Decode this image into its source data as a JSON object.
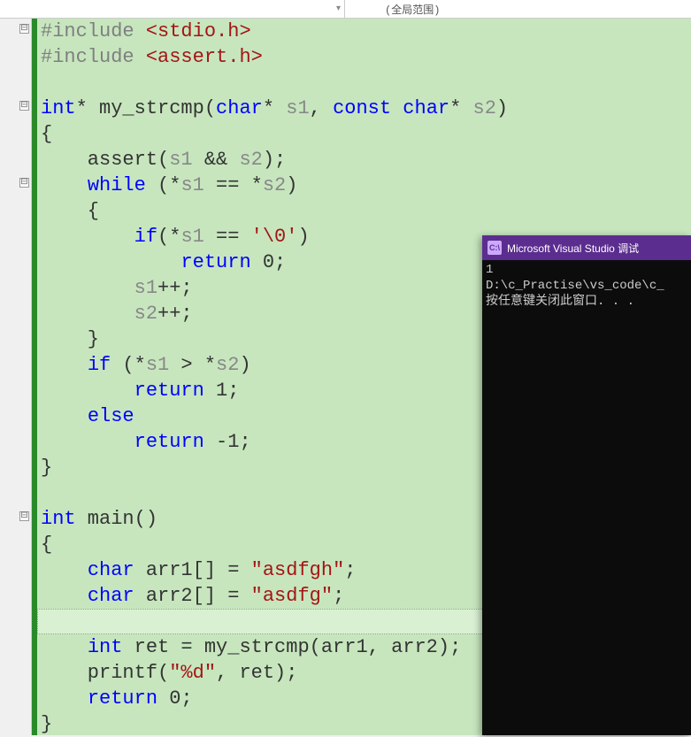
{
  "topbar": {
    "scope_label": "(全局范围)"
  },
  "fold": {
    "m1": "⊟",
    "m2": "⊟",
    "m3": "⊟",
    "m4": "⊟"
  },
  "code": {
    "l1_a": "#include ",
    "l1_b": "<stdio.h>",
    "l2_a": "#include ",
    "l2_b": "<assert.h>",
    "l4_a": "int",
    "l4_b": "* my_strcmp(",
    "l4_c": "char",
    "l4_d": "* ",
    "l4_e": "s1",
    "l4_f": ", ",
    "l4_g": "const",
    "l4_h": " ",
    "l4_i": "char",
    "l4_j": "* ",
    "l4_k": "s2",
    "l4_l": ")",
    "l5": "{",
    "l6_a": "    assert(",
    "l6_b": "s1",
    "l6_c": " && ",
    "l6_d": "s2",
    "l6_e": ");",
    "l7_a": "    ",
    "l7_b": "while",
    "l7_c": " (*",
    "l7_d": "s1",
    "l7_e": " == *",
    "l7_f": "s2",
    "l7_g": ")",
    "l8": "    {",
    "l9_a": "        ",
    "l9_b": "if",
    "l9_c": "(*",
    "l9_d": "s1",
    "l9_e": " == ",
    "l9_f": "'\\0'",
    "l9_g": ")",
    "l10_a": "            ",
    "l10_b": "return",
    "l10_c": " 0;",
    "l11_a": "        ",
    "l11_b": "s1",
    "l11_c": "++;",
    "l12_a": "        ",
    "l12_b": "s2",
    "l12_c": "++;",
    "l13": "    }",
    "l14_a": "    ",
    "l14_b": "if",
    "l14_c": " (*",
    "l14_d": "s1",
    "l14_e": " > *",
    "l14_f": "s2",
    "l14_g": ")",
    "l15_a": "        ",
    "l15_b": "return",
    "l15_c": " 1;",
    "l16_a": "    ",
    "l16_b": "else",
    "l17_a": "        ",
    "l17_b": "return",
    "l17_c": " -1;",
    "l18": "}",
    "l20_a": "int",
    "l20_b": " main()",
    "l21": "{",
    "l22_a": "    ",
    "l22_b": "char",
    "l22_c": " arr1[] = ",
    "l22_d": "\"asdfgh\"",
    "l22_e": ";",
    "l23_a": "    ",
    "l23_b": "char",
    "l23_c": " arr2[] = ",
    "l23_d": "\"asdfg\"",
    "l23_e": ";",
    "l24": "    ",
    "l25_a": "    ",
    "l25_b": "int",
    "l25_c": " ret = my_strcmp(arr1, arr2);",
    "l26_a": "    printf(",
    "l26_b": "\"%d\"",
    "l26_c": ", ret);",
    "l27_a": "    ",
    "l27_b": "return",
    "l27_c": " 0;",
    "l28": "}"
  },
  "console": {
    "title": "Microsoft Visual Studio 调试",
    "icon_text": "C:\\",
    "line1": "1",
    "line2": "D:\\c_Practise\\vs_code\\c_",
    "line3": "按任意键关闭此窗口. . ."
  }
}
